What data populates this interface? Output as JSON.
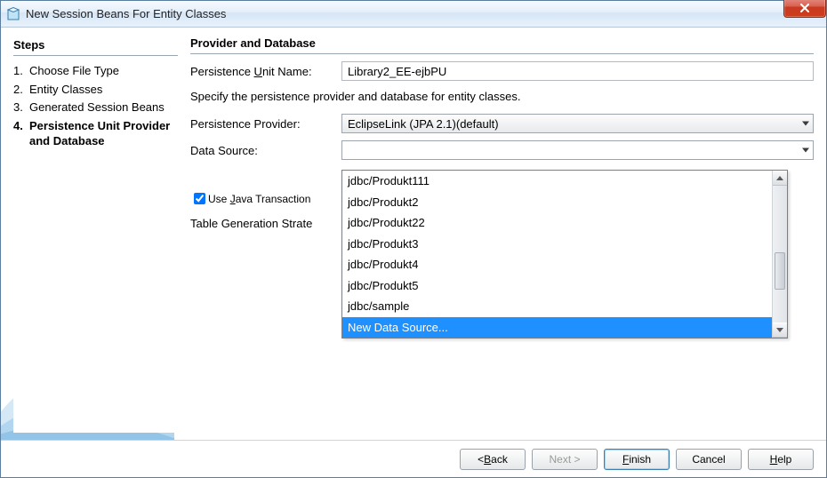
{
  "titlebar": {
    "title": "New Session Beans For Entity Classes"
  },
  "steps": {
    "header": "Steps",
    "items": [
      {
        "num": "1.",
        "label": "Choose File Type",
        "current": false
      },
      {
        "num": "2.",
        "label": "Entity Classes",
        "current": false
      },
      {
        "num": "3.",
        "label": "Generated Session Beans",
        "current": false
      },
      {
        "num": "4.",
        "label": "Persistence Unit Provider and Database",
        "current": true
      }
    ]
  },
  "form": {
    "header": "Provider and Database",
    "pu_label_pre": "Persistence ",
    "pu_label_u": "U",
    "pu_label_post": "nit Name:",
    "pu_value": "Library2_EE-ejbPU",
    "desc": "Specify the persistence provider and database for entity classes.",
    "provider_label": "Persistence Provider:",
    "provider_value": "EclipseLink (JPA 2.1)(default)",
    "ds_label": "Data Source:",
    "ds_value": "",
    "jta_label_pre": "Use ",
    "jta_label_u": "J",
    "jta_label_post": "ava Transaction",
    "tgs_label": "Table Generation Strate",
    "dropdown": [
      "jdbc/Produkt111",
      "jdbc/Produkt2",
      "jdbc/Produkt22",
      "jdbc/Produkt3",
      "jdbc/Produkt4",
      "jdbc/Produkt5",
      "jdbc/sample",
      "New Data Source..."
    ],
    "dropdown_selected_index": 7
  },
  "buttons": {
    "back_pre": "< ",
    "back_u": "B",
    "back_post": "ack",
    "next": "Next >",
    "finish_u": "F",
    "finish_post": "inish",
    "cancel": "Cancel",
    "help_u": "H",
    "help_post": "elp"
  }
}
